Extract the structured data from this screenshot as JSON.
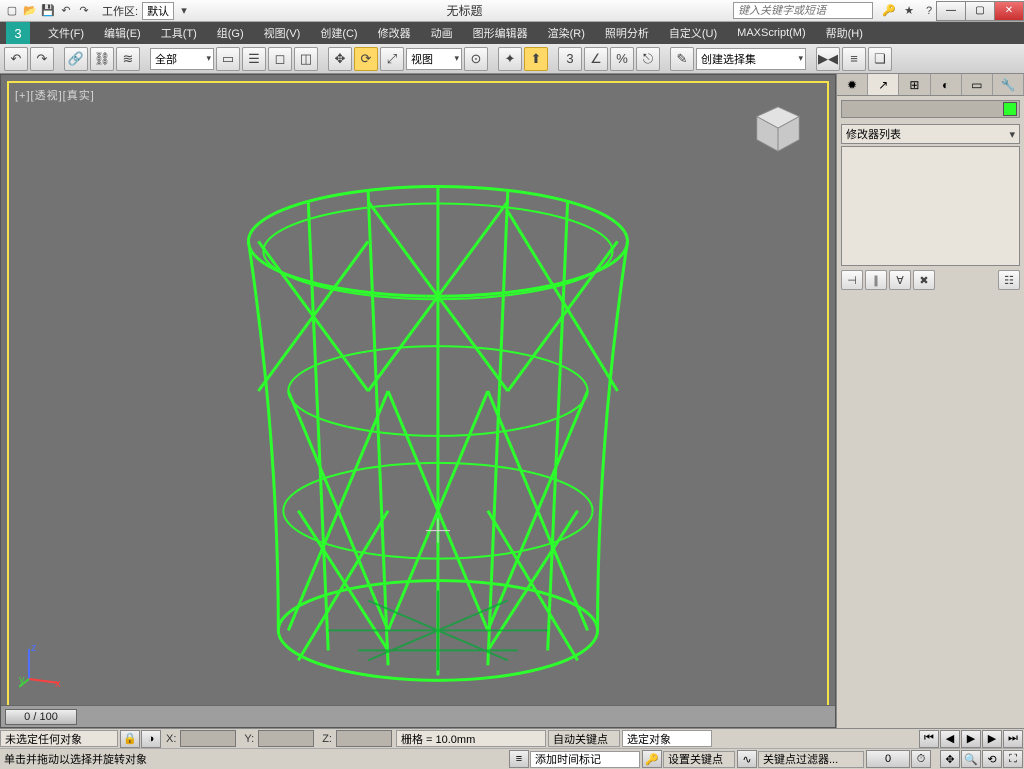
{
  "titlebar": {
    "workspace_label": "工作区:",
    "workspace_value": "默认",
    "title": "无标题",
    "search_placeholder": "键入关键字或短语"
  },
  "menu": {
    "items": [
      "文件(F)",
      "编辑(E)",
      "工具(T)",
      "组(G)",
      "视图(V)",
      "创建(C)",
      "修改器",
      "动画",
      "图形编辑器",
      "渲染(R)",
      "照明分析",
      "自定义(U)",
      "MAXScript(M)",
      "帮助(H)"
    ]
  },
  "toolbar": {
    "filter_dd": "全部",
    "coord_dd": "视图",
    "set_dd": "创建选择集"
  },
  "viewport": {
    "label": "[+][透视][真实]",
    "time": "0 / 100",
    "axes": {
      "x": "x",
      "y": "y",
      "z": "z"
    }
  },
  "panel": {
    "modifier_dd": "修改器列表"
  },
  "status": {
    "selection": "未选定任何对象",
    "x": "X:",
    "y": "Y:",
    "z": "Z:",
    "grid": "栅格 = 10.0mm",
    "autokey": "自动关键点",
    "selobj": "选定对象",
    "hint": "单击并拖动以选择并旋转对象",
    "add_marker": "添加时间标记",
    "setkey": "设置关键点",
    "keyfilter": "关键点过滤器..."
  },
  "colors": {
    "accent": "#ffd866",
    "viewport_border": "#f6e24a",
    "object": "#2cff2c"
  }
}
